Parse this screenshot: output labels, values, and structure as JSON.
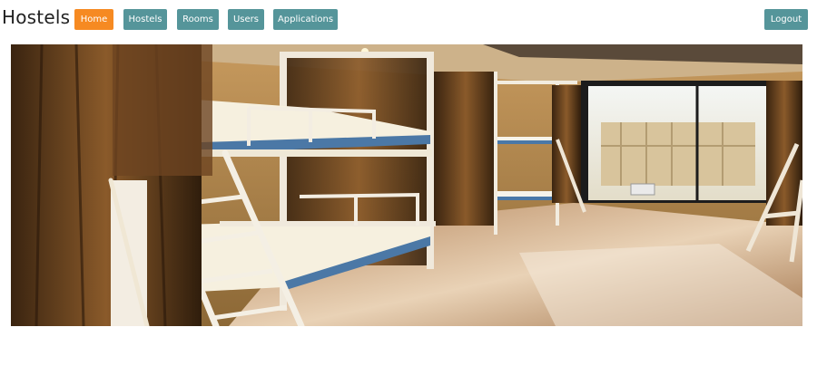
{
  "navbar": {
    "brand": "Hostels",
    "items": [
      {
        "label": "Home",
        "active": true
      },
      {
        "label": "Hostels",
        "active": false
      },
      {
        "label": "Rooms",
        "active": false
      },
      {
        "label": "Users",
        "active": false
      },
      {
        "label": "Applications",
        "active": false
      }
    ],
    "logout_label": "Logout"
  },
  "hero": {
    "subject": "hostel-dormitory-bunk-beds-photo"
  },
  "colors": {
    "nav_button": "#55959a",
    "nav_button_active": "#f68a22",
    "nav_text": "#ffffff",
    "brand_text": "#222222"
  }
}
